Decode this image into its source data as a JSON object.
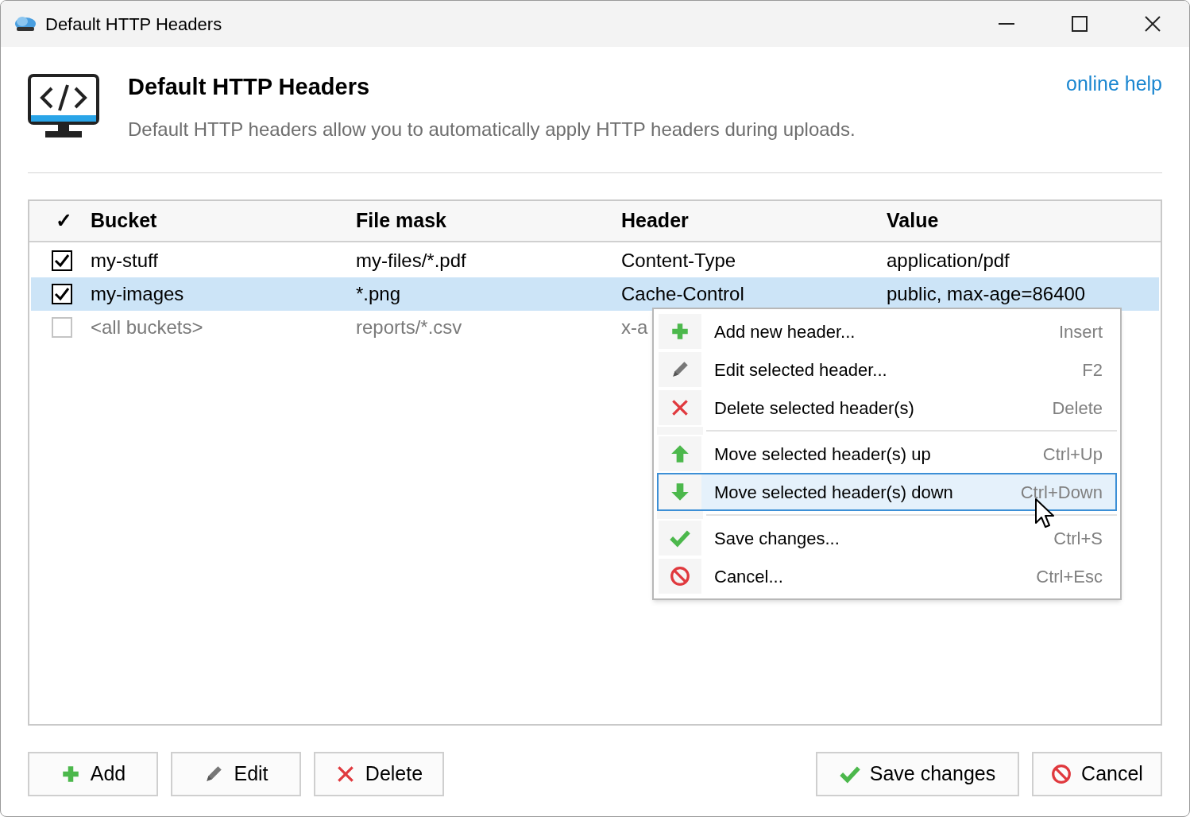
{
  "window": {
    "title": "Default HTTP Headers"
  },
  "header": {
    "title": "Default HTTP Headers",
    "description": "Default HTTP headers allow you to automatically apply HTTP headers during uploads.",
    "help_link": "online help"
  },
  "table": {
    "columns": [
      "✓",
      "Bucket",
      "File mask",
      "Header",
      "Value"
    ],
    "rows": [
      {
        "checked": true,
        "selected": false,
        "disabled": false,
        "bucket": "my-stuff",
        "file_mask": "my-files/*.pdf",
        "header": "Content-Type",
        "value": "application/pdf"
      },
      {
        "checked": true,
        "selected": true,
        "disabled": false,
        "bucket": "my-images",
        "file_mask": "*.png",
        "header": "Cache-Control",
        "value": "public, max-age=86400"
      },
      {
        "checked": false,
        "selected": false,
        "disabled": true,
        "bucket": "<all buckets>",
        "file_mask": "reports/*.csv",
        "header": "x-a"
      }
    ]
  },
  "context_menu": [
    {
      "kind": "add",
      "label": "Add new header...",
      "shortcut": "Insert",
      "selected": false,
      "separator_after": false
    },
    {
      "kind": "edit",
      "label": "Edit selected header...",
      "shortcut": "F2",
      "selected": false,
      "separator_after": false
    },
    {
      "kind": "delete",
      "label": "Delete selected header(s)",
      "shortcut": "Delete",
      "selected": false,
      "separator_after": true
    },
    {
      "kind": "up",
      "label": "Move selected header(s) up",
      "shortcut": "Ctrl+Up",
      "selected": false,
      "separator_after": false
    },
    {
      "kind": "down",
      "label": "Move selected header(s) down",
      "shortcut": "Ctrl+Down",
      "selected": true,
      "separator_after": true
    },
    {
      "kind": "save",
      "label": "Save changes...",
      "shortcut": "Ctrl+S",
      "selected": false,
      "separator_after": false
    },
    {
      "kind": "cancel",
      "label": "Cancel...",
      "shortcut": "Ctrl+Esc",
      "selected": false,
      "separator_after": false
    }
  ],
  "buttons_left": [
    {
      "kind": "add",
      "label": "Add"
    },
    {
      "kind": "edit",
      "label": "Edit"
    },
    {
      "kind": "delete",
      "label": "Delete"
    }
  ],
  "buttons_right": [
    {
      "kind": "save",
      "label": "Save changes"
    },
    {
      "kind": "cancel",
      "label": "Cancel"
    }
  ]
}
